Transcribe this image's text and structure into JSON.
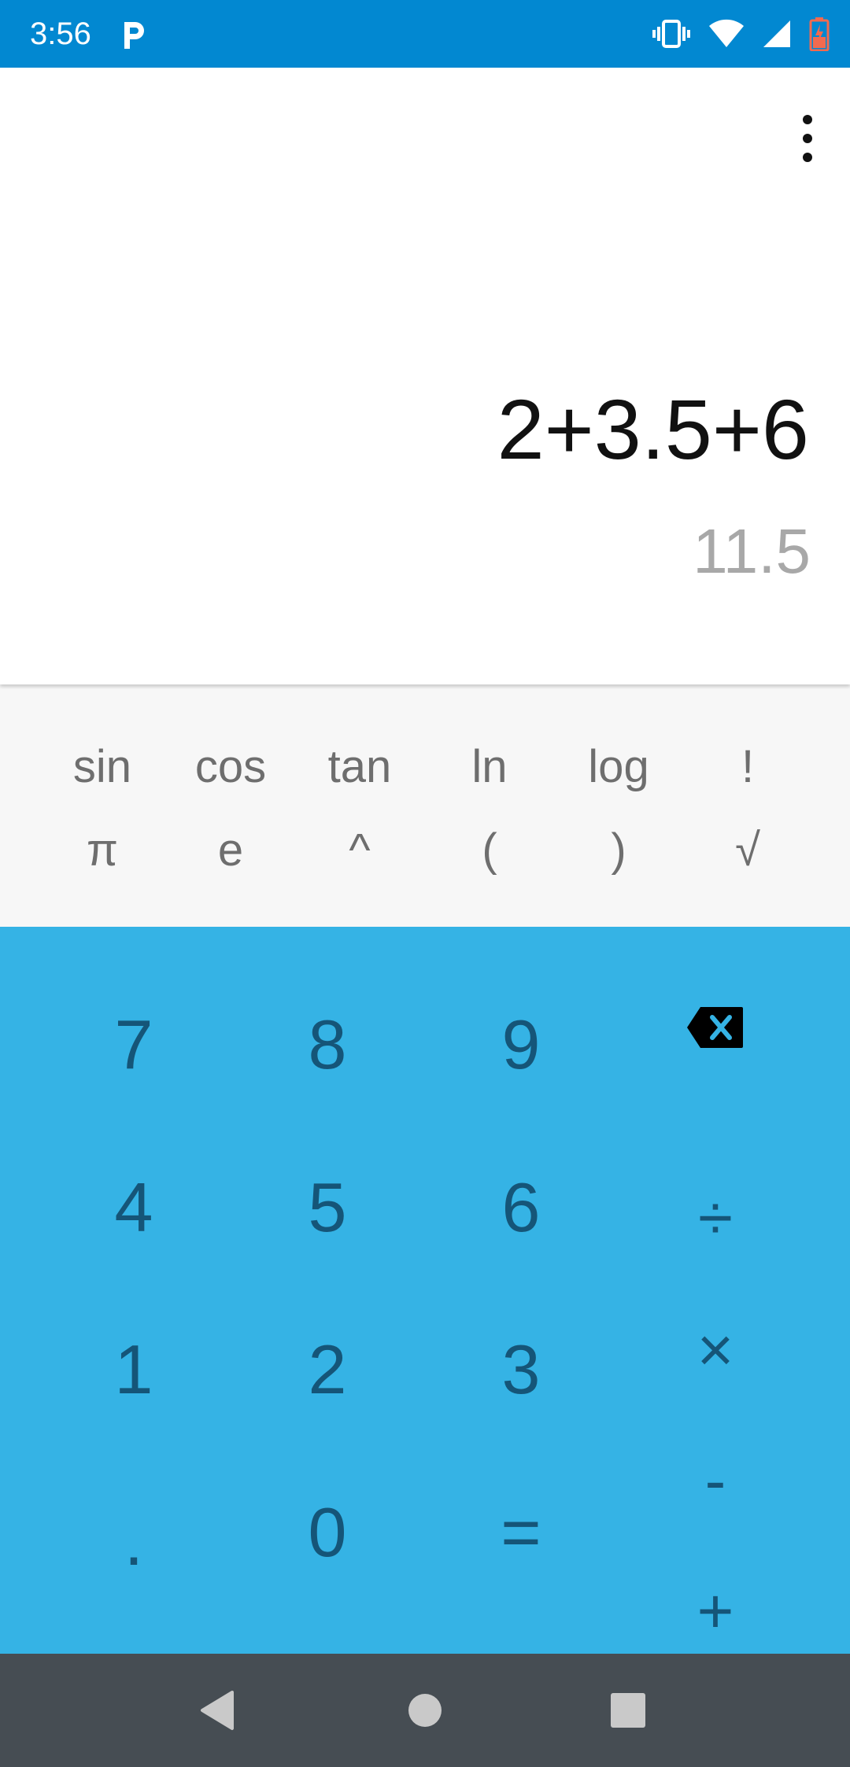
{
  "status_bar": {
    "time": "3:56",
    "notification_icon": "parking-app-icon",
    "icons": [
      "vibrate-icon",
      "wifi-icon",
      "cell-signal-icon",
      "battery-low-icon"
    ],
    "background_color": "#0288d1"
  },
  "display": {
    "expression": "2+3.5+6",
    "result": "11.5",
    "menu_icon": "overflow-menu-icon"
  },
  "advanced_panel": {
    "row1": [
      "sin",
      "cos",
      "tan",
      "ln",
      "log",
      "!"
    ],
    "row2": [
      "π",
      "e",
      "^",
      "(",
      ")",
      "√"
    ],
    "background_color": "#f7f7f7"
  },
  "keypad": {
    "digits": {
      "seven": "7",
      "eight": "8",
      "nine": "9",
      "four": "4",
      "five": "5",
      "six": "6",
      "one": "1",
      "two": "2",
      "three": "3",
      "dot": ".",
      "zero": "0",
      "equals": "="
    },
    "operators": {
      "backspace": "backspace-icon",
      "divide": "÷",
      "multiply": "×",
      "minus": "-",
      "plus": "+"
    },
    "background_color": "#35b3e5",
    "text_color": "#155578"
  },
  "nav_bar": {
    "buttons": [
      "back-icon",
      "home-icon",
      "recents-icon"
    ],
    "background_color": "#464d53"
  }
}
